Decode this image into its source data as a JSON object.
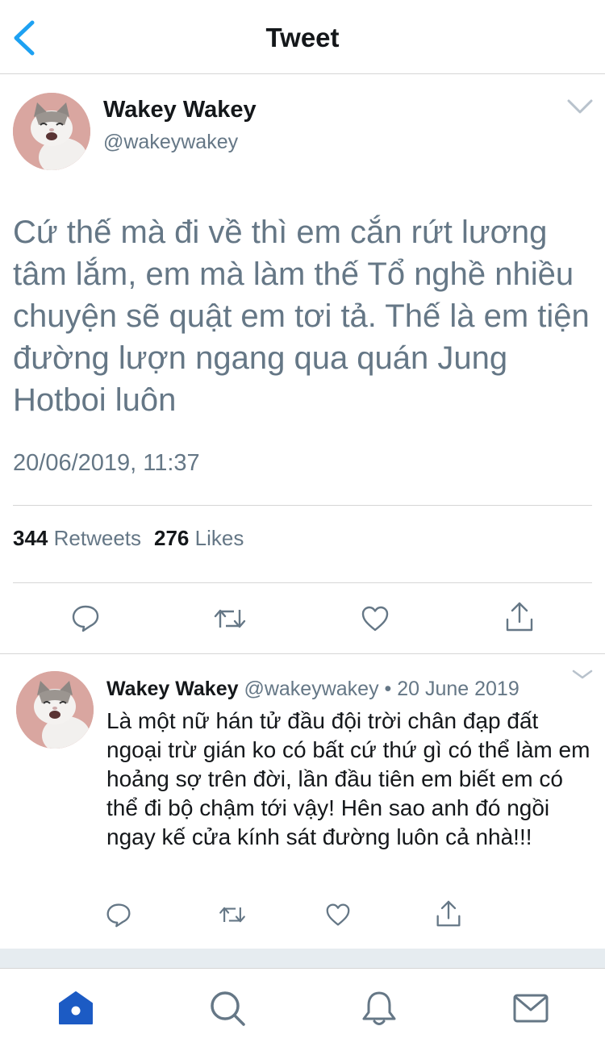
{
  "header": {
    "title": "Tweet"
  },
  "tweet": {
    "author_name": "Wakey Wakey",
    "author_handle": "@wakeywakey",
    "text": "Cứ thế mà đi về thì em cắn rứt lương tâm lắm, em mà làm thế Tổ nghề nhiều chuyện sẽ quật em tơi tả. Thế là em tiện đường lượn ngang qua quán Jung Hotboi luôn",
    "timestamp": "20/06/2019, 11:37",
    "retweets_count": "344",
    "retweets_label": "Retweets",
    "likes_count": "276",
    "likes_label": "Likes"
  },
  "reply": {
    "author_name": "Wakey Wakey",
    "meta": "@wakeywakey • 20 June 2019",
    "text": "Là một nữ hán tử đầu đội trời chân đạp đất ngoại trừ gián ko có bất cứ thứ gì có thể làm em hoảng sợ trên đời, lần đầu tiên em biết em có thể đi bộ chậm tới vậy! Hên sao anh đó ngồi ngay kế cửa kính sát đường luôn cả nhà!!!"
  },
  "icons": {
    "back": "chevron-left-icon",
    "more": "chevron-down-icon",
    "reply": "reply-icon",
    "retweet": "retweet-icon",
    "like": "heart-icon",
    "share": "share-icon",
    "tabs": [
      "home-icon",
      "search-icon",
      "bell-icon",
      "mail-icon"
    ]
  },
  "colors": {
    "accent": "#1da1f2",
    "active_tab": "#1c5bc4",
    "icon_gray": "#657786",
    "text": "#14171a",
    "avatar_bg": "#d9a6a0"
  }
}
